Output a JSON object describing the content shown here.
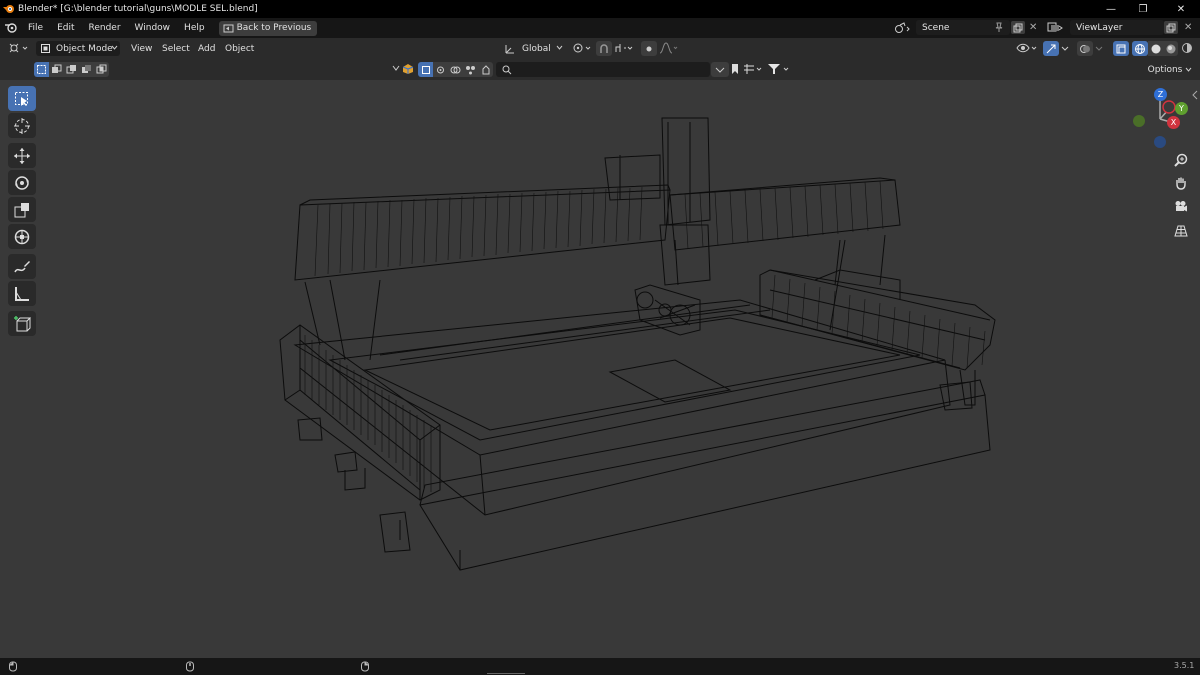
{
  "window": {
    "title": "Blender* [G:\\blender tutorial\\guns\\MODLE SEL.blend]",
    "minimize": "—",
    "maximize": "❐",
    "close": "✕"
  },
  "menubar": {
    "items": [
      "File",
      "Edit",
      "Render",
      "Window",
      "Help"
    ],
    "back_label": "Back to Previous",
    "scene_label": "Scene",
    "viewlayer_label": "ViewLayer"
  },
  "header": {
    "mode_label": "Object Mode",
    "menus": [
      "View",
      "Select",
      "Add",
      "Object"
    ],
    "orientation_label": "Global"
  },
  "subheader": {
    "search_placeholder": "",
    "options_label": "Options"
  },
  "gizmo": {
    "z_label": "Z",
    "y_label": "Y",
    "x_label": "X",
    "z_color": "#2f6fd6",
    "y_color": "#5f9f2f",
    "x_color": "#d1333e"
  },
  "toolbar": {
    "tools": [
      "select-box",
      "cursor",
      "move",
      "rotate",
      "scale",
      "transform",
      "annotate",
      "measure",
      "add-cube"
    ]
  },
  "status": {
    "version": "3.5.1"
  },
  "colors": {
    "accent": "#4772b3",
    "viewport_bg": "#393939",
    "wire": "#0a0a0a"
  }
}
